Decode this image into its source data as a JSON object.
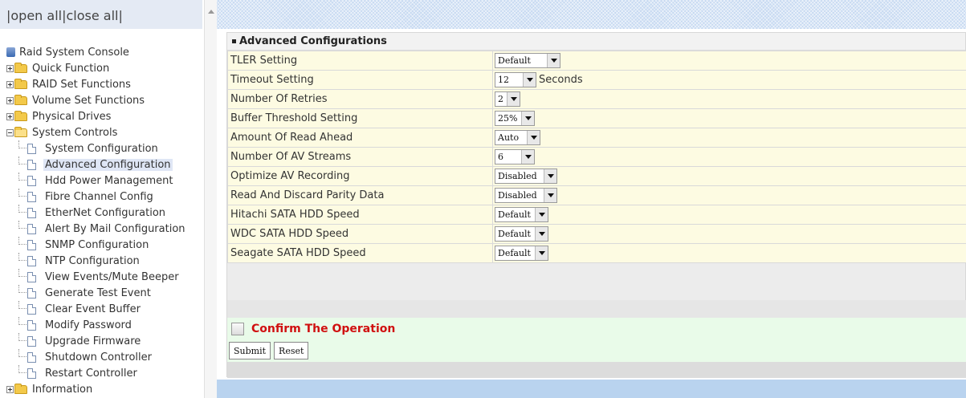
{
  "sidebar": {
    "open_all": "|open all",
    "close_all": "|close all|",
    "root_label": "Raid System Console",
    "items": [
      {
        "label": "Quick Function",
        "expanded": false
      },
      {
        "label": "RAID Set Functions",
        "expanded": false
      },
      {
        "label": "Volume Set Functions",
        "expanded": false
      },
      {
        "label": "Physical Drives",
        "expanded": false
      },
      {
        "label": "System Controls",
        "expanded": true
      }
    ],
    "children": [
      "System Configuration",
      "Advanced Configuration",
      "Hdd Power Management",
      "Fibre Channel Config",
      "EtherNet Configuration",
      "Alert By Mail Configuration",
      "SNMP Configuration",
      "NTP Configuration",
      "View Events/Mute Beeper",
      "Generate Test Event",
      "Clear Event Buffer",
      "Modify Password",
      "Upgrade Firmware",
      "Shutdown Controller",
      "Restart Controller"
    ],
    "selected_child": "Advanced Configuration",
    "last_item": {
      "label": "Information",
      "expanded": false
    }
  },
  "main": {
    "section_title": "Advanced Configurations",
    "rows": [
      {
        "label": "TLER Setting",
        "value": "Default",
        "suffix": ""
      },
      {
        "label": "Timeout Setting",
        "value": "12",
        "suffix": "Seconds"
      },
      {
        "label": "Number Of Retries",
        "value": "2",
        "suffix": ""
      },
      {
        "label": "Buffer Threshold Setting",
        "value": "25%",
        "suffix": ""
      },
      {
        "label": "Amount Of Read Ahead",
        "value": "Auto",
        "suffix": ""
      },
      {
        "label": "Number Of AV Streams",
        "value": "6",
        "suffix": ""
      },
      {
        "label": "Optimize AV Recording",
        "value": "Disabled",
        "suffix": ""
      },
      {
        "label": "Read And Discard Parity Data",
        "value": "Disabled",
        "suffix": ""
      },
      {
        "label": "Hitachi SATA HDD Speed",
        "value": "Default",
        "suffix": ""
      },
      {
        "label": "WDC SATA HDD Speed",
        "value": "Default",
        "suffix": ""
      },
      {
        "label": "Seagate SATA HDD Speed",
        "value": "Default",
        "suffix": ""
      }
    ],
    "confirm_label": "Confirm The Operation",
    "submit_label": "Submit",
    "reset_label": "Reset"
  },
  "colors": {
    "row_bg": "#fdfbe2",
    "confirm_bg": "#e9fbe9",
    "confirm_text": "#d01010",
    "header_band": "#c6d9f1"
  }
}
